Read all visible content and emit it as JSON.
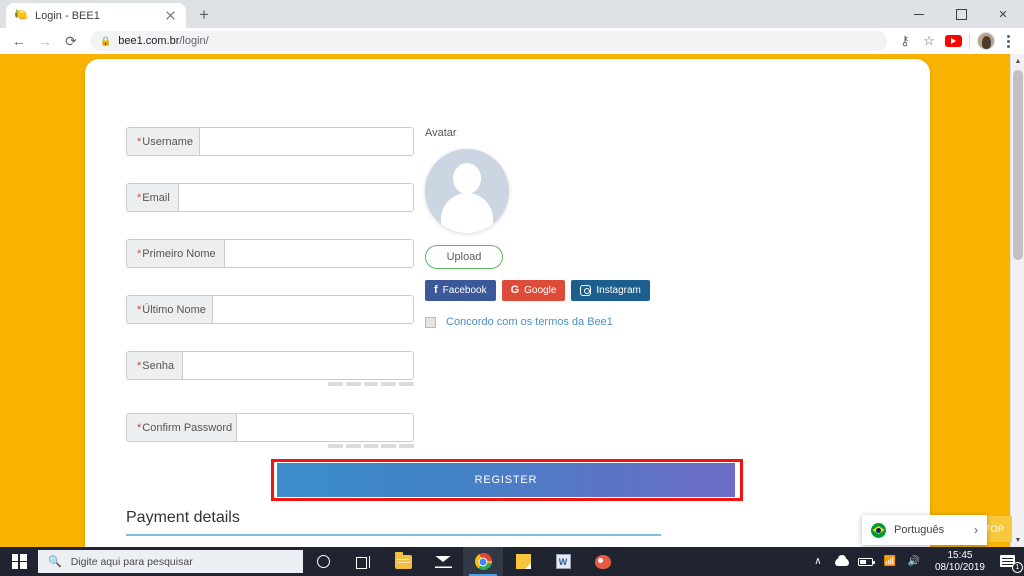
{
  "browser": {
    "tab": {
      "favicon": "bee-icon",
      "title": "Login - BEE1",
      "close_label": ""
    },
    "new_tab_label": "+",
    "nav": {
      "back": "←",
      "forward": "→",
      "reload": "⟳"
    },
    "omnibox": {
      "lock": "🔒",
      "url_secure": "bee1.com.br",
      "url_path": "/login/"
    },
    "toolbar_icons": [
      {
        "name": "password-key-icon",
        "glyph": "⚷"
      },
      {
        "name": "bookmark-star-icon",
        "glyph": "☆"
      },
      {
        "name": "youtube-extension-icon",
        "glyph": ""
      },
      {
        "name": "profile-avatar",
        "glyph": ""
      },
      {
        "name": "chrome-menu-icon",
        "glyph": ""
      }
    ],
    "window_controls": {
      "minimize": "",
      "maximize": "",
      "close": "✕"
    }
  },
  "page": {
    "form": {
      "fields": [
        {
          "name": "username",
          "required": "*",
          "label": "Username",
          "value": "",
          "placeholder": "",
          "label_width": 73,
          "meter": false
        },
        {
          "name": "email",
          "required": "*",
          "label": "Email",
          "value": "",
          "placeholder": "",
          "label_width": 52,
          "meter": false
        },
        {
          "name": "first-name",
          "required": "*",
          "label": "Primeiro Nome",
          "value": "",
          "placeholder": "",
          "label_width": 98,
          "meter": false
        },
        {
          "name": "last-name",
          "required": "*",
          "label": "Último Nome",
          "value": "",
          "placeholder": "",
          "label_width": 86,
          "meter": false
        },
        {
          "name": "password",
          "required": "*",
          "label": "Senha",
          "value": "",
          "placeholder": "",
          "label_width": 56,
          "meter": true
        },
        {
          "name": "confirm-password",
          "required": "*",
          "label": "Confirm Password",
          "value": "",
          "placeholder": "",
          "label_width": 110,
          "meter": true
        }
      ],
      "password_meter_segments": 5,
      "register_label": "REGISTER",
      "register_gradient_from": "#3b8ecb",
      "register_gradient_to": "#6f6dc6",
      "highlight_color": "#f21313"
    },
    "avatar_section": {
      "label": "Avatar",
      "upload_label": "Upload",
      "upload_border_color": "#5cb85c"
    },
    "social_buttons": [
      {
        "name": "facebook",
        "label": "Facebook",
        "glyph": "f",
        "color": "#3b5998"
      },
      {
        "name": "google",
        "label": "Google",
        "glyph": "G",
        "color": "#dd4b39"
      },
      {
        "name": "instagram",
        "label": "Instagram",
        "glyph": "",
        "color": "#1c5f8f"
      }
    ],
    "terms": {
      "checked": false,
      "link_text": "Concordo com os termos da Bee1",
      "link_color": "#4a90c4"
    },
    "payment_heading": "Payment details",
    "language_widget": {
      "flag": "brazil-flag",
      "name": "Português",
      "chevron": "›"
    },
    "back_to_top": {
      "arrow": "▲",
      "label": "TOP"
    },
    "background_color": "#f8b200"
  },
  "taskbar": {
    "start_label": "",
    "search_placeholder": "Digite aqui para pesquisar",
    "apps": [
      {
        "name": "cortana",
        "label": ""
      },
      {
        "name": "task-view",
        "label": ""
      },
      {
        "name": "file-explorer",
        "label": ""
      },
      {
        "name": "mail",
        "label": ""
      },
      {
        "name": "chrome",
        "label": "",
        "active": true
      },
      {
        "name": "sticky-notes",
        "label": ""
      },
      {
        "name": "word",
        "label": "W"
      },
      {
        "name": "paint",
        "label": ""
      }
    ],
    "tray": {
      "chevron": "∧",
      "onedrive": "",
      "battery": "",
      "wifi": "📶",
      "volume": "🔊",
      "time": "15:45",
      "date": "08/10/2019",
      "notification_count": "1"
    }
  }
}
